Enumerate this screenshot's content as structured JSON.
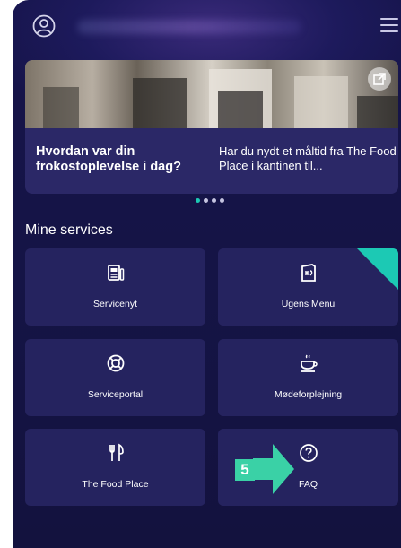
{
  "header": {
    "avatar_icon": "user-circle-icon",
    "menu_icon": "hamburger-menu-icon"
  },
  "banner": {
    "slides": [
      {
        "title": "Hvordan var din frokostoplevelse i dag?"
      },
      {
        "title": "Har du nydt et måltid fra The Food Place i kantinen til..."
      }
    ],
    "open_icon": "external-link-icon",
    "active_dot": 0,
    "dot_count": 4
  },
  "services": {
    "title": "Mine services",
    "tiles": [
      {
        "label": "Servicenyt",
        "icon": "news-icon"
      },
      {
        "label": "Ugens Menu",
        "icon": "menu-card-icon",
        "highlighted": true
      },
      {
        "label": "Serviceportal",
        "icon": "lifebuoy-icon"
      },
      {
        "label": "Mødeforplejning",
        "icon": "coffee-cup-icon"
      },
      {
        "label": "The Food Place",
        "icon": "fork-knife-icon"
      },
      {
        "label": "FAQ",
        "icon": "question-circle-icon"
      }
    ]
  },
  "annotation": {
    "step": "5",
    "color": "#3ad1a6"
  },
  "colors": {
    "background": "#16144a",
    "tile": "#25235f",
    "accent": "#1cc9b4"
  }
}
